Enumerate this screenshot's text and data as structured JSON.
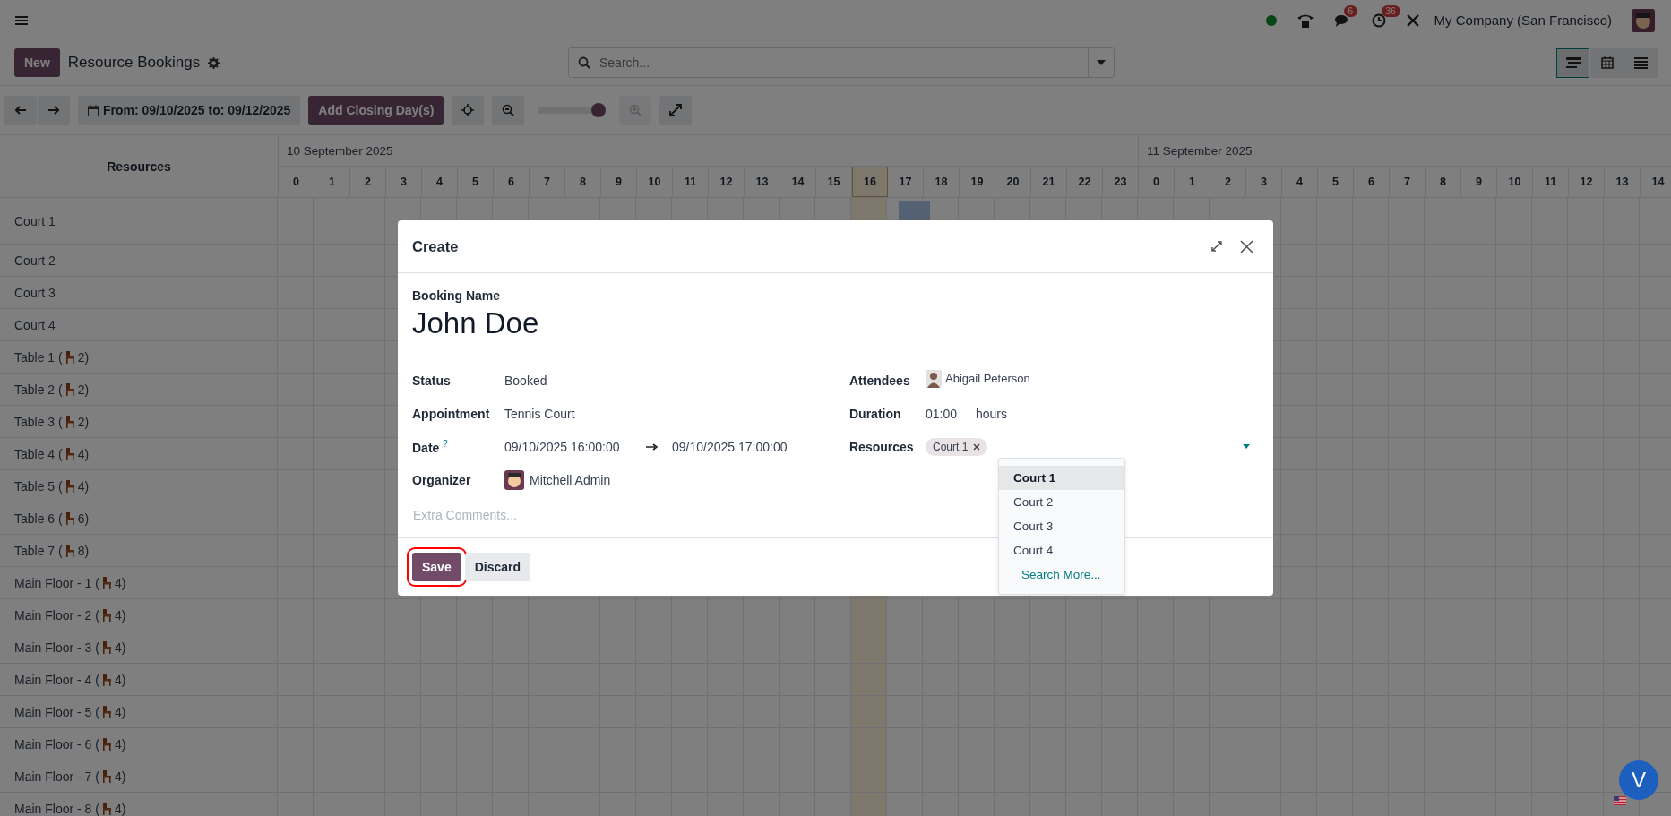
{
  "navbar": {
    "presence_online": true,
    "chat_badge": "6",
    "activity_badge": "36",
    "company": "My Company (San Francisco)"
  },
  "control_panel": {
    "new_button": "New",
    "title": "Resource Bookings",
    "search": {
      "placeholder": "Search..."
    },
    "views": [
      {
        "kind": "gantt",
        "selected": true
      },
      {
        "kind": "calendar",
        "selected": false
      },
      {
        "kind": "list",
        "selected": false
      }
    ]
  },
  "toolbar": {
    "date_range": "From: 09/10/2025 to: 09/12/2025",
    "closing_button": "Add Closing Day(s)",
    "zoom": {
      "level": 1
    }
  },
  "gantt": {
    "resources_heading": "Resources",
    "days": [
      {
        "label": "10 September 2025",
        "hours": [
          {
            "label": "0",
            "current": false
          },
          {
            "label": "1",
            "current": false
          },
          {
            "label": "2",
            "current": false
          },
          {
            "label": "3",
            "current": false
          },
          {
            "label": "4",
            "current": false
          },
          {
            "label": "5",
            "current": false
          },
          {
            "label": "6",
            "current": false
          },
          {
            "label": "7",
            "current": false
          },
          {
            "label": "8",
            "current": false
          },
          {
            "label": "9",
            "current": false
          },
          {
            "label": "10",
            "current": false
          },
          {
            "label": "11",
            "current": false
          },
          {
            "label": "12",
            "current": false
          },
          {
            "label": "13",
            "current": false
          },
          {
            "label": "14",
            "current": false
          },
          {
            "label": "15",
            "current": false
          },
          {
            "label": "16",
            "current": true
          },
          {
            "label": "17",
            "current": false,
            "booked": true
          },
          {
            "label": "18",
            "current": false
          },
          {
            "label": "19",
            "current": false
          },
          {
            "label": "20",
            "current": false
          },
          {
            "label": "21",
            "current": false
          },
          {
            "label": "22",
            "current": false
          },
          {
            "label": "23",
            "current": false
          }
        ]
      },
      {
        "label": "11 September 2025",
        "hours": [
          {
            "label": "0",
            "current": false
          },
          {
            "label": "1",
            "current": false
          },
          {
            "label": "2",
            "current": false
          },
          {
            "label": "3",
            "current": false
          },
          {
            "label": "4",
            "current": false
          },
          {
            "label": "5",
            "current": false
          },
          {
            "label": "6",
            "current": false
          },
          {
            "label": "7",
            "current": false
          },
          {
            "label": "8",
            "current": false
          },
          {
            "label": "9",
            "current": false
          },
          {
            "label": "10",
            "current": false
          },
          {
            "label": "11",
            "current": false
          },
          {
            "label": "12",
            "current": false
          },
          {
            "label": "13",
            "current": false
          },
          {
            "label": "14",
            "current": false
          }
        ]
      }
    ],
    "resources": [
      {
        "kind": "plain",
        "name": "Court 1",
        "booked": true
      },
      {
        "kind": "plain",
        "name": "Court 2"
      },
      {
        "kind": "plain",
        "name": "Court 3"
      },
      {
        "kind": "plain",
        "name": "Court 4"
      },
      {
        "kind": "seats",
        "name": "Table 1 (",
        "seats": "2)"
      },
      {
        "kind": "seats",
        "name": "Table 2 (",
        "seats": "2)"
      },
      {
        "kind": "seats",
        "name": "Table 3 (",
        "seats": "2)"
      },
      {
        "kind": "seats",
        "name": "Table 4 (",
        "seats": "4)"
      },
      {
        "kind": "seats",
        "name": "Table 5 (",
        "seats": "4)"
      },
      {
        "kind": "seats",
        "name": "Table 6 (",
        "seats": "6)"
      },
      {
        "kind": "seats",
        "name": "Table 7 (",
        "seats": "8)"
      },
      {
        "kind": "seats",
        "name": "Main Floor - 1 (",
        "seats": "4)"
      },
      {
        "kind": "seats",
        "name": "Main Floor - 2 (",
        "seats": "4)"
      },
      {
        "kind": "seats",
        "name": "Main Floor - 3 (",
        "seats": "4)"
      },
      {
        "kind": "seats",
        "name": "Main Floor - 4 (",
        "seats": "4)"
      },
      {
        "kind": "seats",
        "name": "Main Floor - 5 (",
        "seats": "4)"
      },
      {
        "kind": "seats",
        "name": "Main Floor - 6 (",
        "seats": "4)"
      },
      {
        "kind": "seats",
        "name": "Main Floor - 7 (",
        "seats": "4)"
      },
      {
        "kind": "seats",
        "name": "Main Floor - 8 (",
        "seats": "4)"
      }
    ]
  },
  "dialog": {
    "title": "Create",
    "name_label": "Booking Name",
    "name_value": "John Doe",
    "left_fields": [
      {
        "kind": "text",
        "label": "Status",
        "value": "Booked"
      },
      {
        "kind": "text",
        "label": "Appointment",
        "value": "Tennis Court"
      },
      {
        "kind": "range",
        "label": "Date",
        "help": "?",
        "value": "09/10/2025 16:00:00",
        "value_end": "09/10/2025 17:00:00"
      },
      {
        "kind": "user",
        "label": "Organizer",
        "value": "Mitchell Admin"
      }
    ],
    "comments": {
      "placeholder": "Extra Comments..."
    },
    "right_fields": [
      {
        "kind": "user_input",
        "label": "Attendees",
        "value": "Abigail Peterson"
      },
      {
        "kind": "duration",
        "label": "Duration",
        "value": "01:00",
        "unit": "hours"
      },
      {
        "kind": "tags",
        "label": "Resources",
        "tags": [
          "Court 1"
        ],
        "options": [
          {
            "kind": "option",
            "label": "Court 1",
            "selected": true
          },
          {
            "kind": "option",
            "label": "Court 2",
            "selected": false
          },
          {
            "kind": "option",
            "label": "Court 3",
            "selected": false
          },
          {
            "kind": "option",
            "label": "Court 4",
            "selected": false
          },
          {
            "kind": "link",
            "label": "Search More...",
            "selected": false
          }
        ]
      }
    ],
    "buttons": [
      {
        "kind": "primary",
        "label": "Save",
        "highlighted": true
      },
      {
        "kind": "secondary",
        "label": "Discard",
        "highlighted": false
      }
    ]
  },
  "assistant_badge": "V"
}
